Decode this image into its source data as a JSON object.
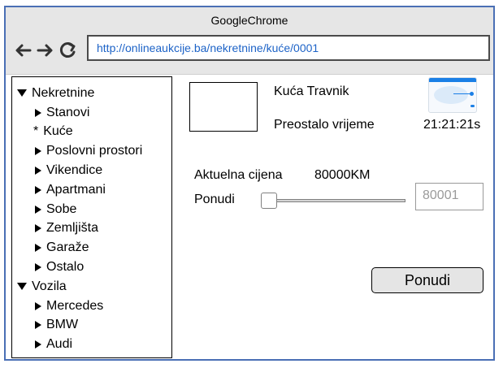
{
  "window": {
    "title": "GoogleChrome"
  },
  "browser": {
    "url": "http://onlineaukcije.ba/nekretnine/kuće/0001",
    "icons": [
      "back-arrow-icon",
      "forward-arrow-icon",
      "reload-icon"
    ]
  },
  "sidebar": {
    "groups": [
      {
        "label": "Nekretnine",
        "items": [
          "Stanovi",
          "Kuće",
          "Poslovni prostori",
          "Vikendice",
          "Apartmani",
          "Sobe",
          "Zemljišta",
          "Garaže",
          "Ostalo"
        ],
        "selected": "Kuće"
      },
      {
        "label": "Vozila",
        "items": [
          "Mercedes",
          "BMW",
          "Audi"
        ]
      }
    ],
    "current_marker": "*"
  },
  "listing": {
    "title": "Kuća Travnik",
    "remaining_label": "Preostalo vrijeme",
    "remaining_value": "21:21:21s",
    "current_price_label": "Aktuelna cijena",
    "current_price_value": "80000KM",
    "offer_label": "Ponudi",
    "offer_placeholder": "80001",
    "submit_label": "Ponudi"
  }
}
